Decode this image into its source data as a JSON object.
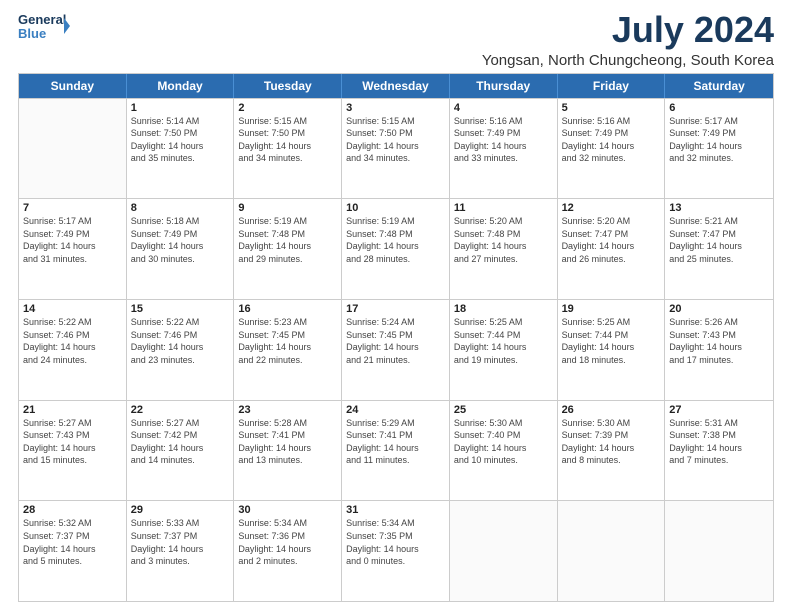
{
  "logo": {
    "line1": "General",
    "line2": "Blue"
  },
  "title": "July 2024",
  "subtitle": "Yongsan, North Chungcheong, South Korea",
  "headers": [
    "Sunday",
    "Monday",
    "Tuesday",
    "Wednesday",
    "Thursday",
    "Friday",
    "Saturday"
  ],
  "rows": [
    [
      {
        "day": "",
        "info": ""
      },
      {
        "day": "1",
        "info": "Sunrise: 5:14 AM\nSunset: 7:50 PM\nDaylight: 14 hours\nand 35 minutes."
      },
      {
        "day": "2",
        "info": "Sunrise: 5:15 AM\nSunset: 7:50 PM\nDaylight: 14 hours\nand 34 minutes."
      },
      {
        "day": "3",
        "info": "Sunrise: 5:15 AM\nSunset: 7:50 PM\nDaylight: 14 hours\nand 34 minutes."
      },
      {
        "day": "4",
        "info": "Sunrise: 5:16 AM\nSunset: 7:49 PM\nDaylight: 14 hours\nand 33 minutes."
      },
      {
        "day": "5",
        "info": "Sunrise: 5:16 AM\nSunset: 7:49 PM\nDaylight: 14 hours\nand 32 minutes."
      },
      {
        "day": "6",
        "info": "Sunrise: 5:17 AM\nSunset: 7:49 PM\nDaylight: 14 hours\nand 32 minutes."
      }
    ],
    [
      {
        "day": "7",
        "info": "Sunrise: 5:17 AM\nSunset: 7:49 PM\nDaylight: 14 hours\nand 31 minutes."
      },
      {
        "day": "8",
        "info": "Sunrise: 5:18 AM\nSunset: 7:49 PM\nDaylight: 14 hours\nand 30 minutes."
      },
      {
        "day": "9",
        "info": "Sunrise: 5:19 AM\nSunset: 7:48 PM\nDaylight: 14 hours\nand 29 minutes."
      },
      {
        "day": "10",
        "info": "Sunrise: 5:19 AM\nSunset: 7:48 PM\nDaylight: 14 hours\nand 28 minutes."
      },
      {
        "day": "11",
        "info": "Sunrise: 5:20 AM\nSunset: 7:48 PM\nDaylight: 14 hours\nand 27 minutes."
      },
      {
        "day": "12",
        "info": "Sunrise: 5:20 AM\nSunset: 7:47 PM\nDaylight: 14 hours\nand 26 minutes."
      },
      {
        "day": "13",
        "info": "Sunrise: 5:21 AM\nSunset: 7:47 PM\nDaylight: 14 hours\nand 25 minutes."
      }
    ],
    [
      {
        "day": "14",
        "info": "Sunrise: 5:22 AM\nSunset: 7:46 PM\nDaylight: 14 hours\nand 24 minutes."
      },
      {
        "day": "15",
        "info": "Sunrise: 5:22 AM\nSunset: 7:46 PM\nDaylight: 14 hours\nand 23 minutes."
      },
      {
        "day": "16",
        "info": "Sunrise: 5:23 AM\nSunset: 7:45 PM\nDaylight: 14 hours\nand 22 minutes."
      },
      {
        "day": "17",
        "info": "Sunrise: 5:24 AM\nSunset: 7:45 PM\nDaylight: 14 hours\nand 21 minutes."
      },
      {
        "day": "18",
        "info": "Sunrise: 5:25 AM\nSunset: 7:44 PM\nDaylight: 14 hours\nand 19 minutes."
      },
      {
        "day": "19",
        "info": "Sunrise: 5:25 AM\nSunset: 7:44 PM\nDaylight: 14 hours\nand 18 minutes."
      },
      {
        "day": "20",
        "info": "Sunrise: 5:26 AM\nSunset: 7:43 PM\nDaylight: 14 hours\nand 17 minutes."
      }
    ],
    [
      {
        "day": "21",
        "info": "Sunrise: 5:27 AM\nSunset: 7:43 PM\nDaylight: 14 hours\nand 15 minutes."
      },
      {
        "day": "22",
        "info": "Sunrise: 5:27 AM\nSunset: 7:42 PM\nDaylight: 14 hours\nand 14 minutes."
      },
      {
        "day": "23",
        "info": "Sunrise: 5:28 AM\nSunset: 7:41 PM\nDaylight: 14 hours\nand 13 minutes."
      },
      {
        "day": "24",
        "info": "Sunrise: 5:29 AM\nSunset: 7:41 PM\nDaylight: 14 hours\nand 11 minutes."
      },
      {
        "day": "25",
        "info": "Sunrise: 5:30 AM\nSunset: 7:40 PM\nDaylight: 14 hours\nand 10 minutes."
      },
      {
        "day": "26",
        "info": "Sunrise: 5:30 AM\nSunset: 7:39 PM\nDaylight: 14 hours\nand 8 minutes."
      },
      {
        "day": "27",
        "info": "Sunrise: 5:31 AM\nSunset: 7:38 PM\nDaylight: 14 hours\nand 7 minutes."
      }
    ],
    [
      {
        "day": "28",
        "info": "Sunrise: 5:32 AM\nSunset: 7:37 PM\nDaylight: 14 hours\nand 5 minutes."
      },
      {
        "day": "29",
        "info": "Sunrise: 5:33 AM\nSunset: 7:37 PM\nDaylight: 14 hours\nand 3 minutes."
      },
      {
        "day": "30",
        "info": "Sunrise: 5:34 AM\nSunset: 7:36 PM\nDaylight: 14 hours\nand 2 minutes."
      },
      {
        "day": "31",
        "info": "Sunrise: 5:34 AM\nSunset: 7:35 PM\nDaylight: 14 hours\nand 0 minutes."
      },
      {
        "day": "",
        "info": ""
      },
      {
        "day": "",
        "info": ""
      },
      {
        "day": "",
        "info": ""
      }
    ]
  ]
}
